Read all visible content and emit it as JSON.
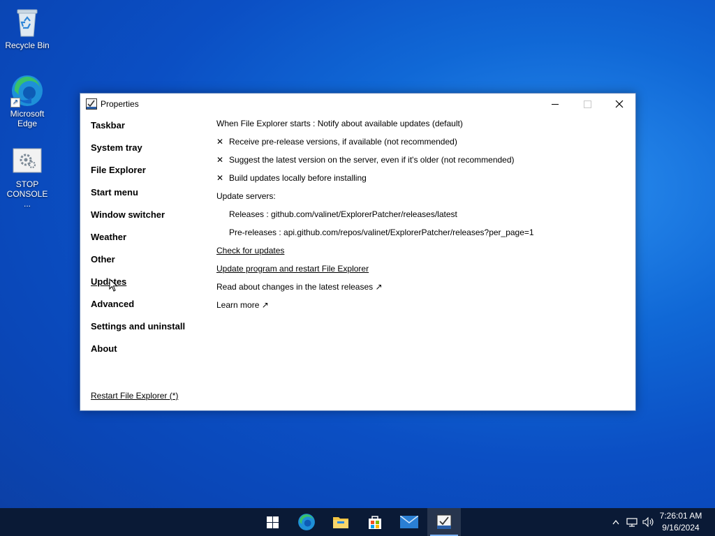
{
  "desktop": {
    "icons": [
      {
        "label": "Recycle Bin",
        "icon": "recycle-bin-icon"
      },
      {
        "label": "Microsoft Edge",
        "icon": "edge-icon"
      },
      {
        "label": "STOP CONSOLE ...",
        "icon": "shortcut-settings-icon"
      }
    ]
  },
  "window": {
    "title": "Properties",
    "nav": [
      {
        "label": "Taskbar"
      },
      {
        "label": "System tray"
      },
      {
        "label": "File Explorer"
      },
      {
        "label": "Start menu"
      },
      {
        "label": "Window switcher"
      },
      {
        "label": "Weather"
      },
      {
        "label": "Other"
      },
      {
        "label": "Updates",
        "active": true
      },
      {
        "label": "Advanced"
      },
      {
        "label": "Settings and uninstall"
      },
      {
        "label": "About"
      }
    ],
    "restart_link": "Restart File Explorer (*)",
    "content": {
      "startup": "When File Explorer starts : Notify about available updates (default)",
      "opt_prerelease": "Receive pre-release versions, if available (not recommended)",
      "opt_suggest_latest": "Suggest the latest version on the server, even if it's older (not recommended)",
      "opt_build_local": "Build updates locally before installing",
      "check_mark": "✕",
      "servers_label": "Update servers:",
      "releases": "Releases : github.com/valinet/ExplorerPatcher/releases/latest",
      "prereleases": "Pre-releases : api.github.com/repos/valinet/ExplorerPatcher/releases?per_page=1",
      "check_updates": "Check for updates",
      "update_restart": "Update program and restart File Explorer",
      "read_changes": "Read about changes in the latest releases ↗",
      "learn_more": "Learn more ↗"
    }
  },
  "taskbar": {
    "apps": [
      "start-icon",
      "edge-icon",
      "file-explorer-icon",
      "store-icon",
      "mail-icon",
      "properties-app-icon"
    ],
    "clock_time": "7:26:01 AM",
    "clock_date": "9/16/2024"
  },
  "colors": {
    "desktop_blue": "#0b4fc4",
    "taskbar": "#0a1a36",
    "accent": "#7fb6ff"
  }
}
